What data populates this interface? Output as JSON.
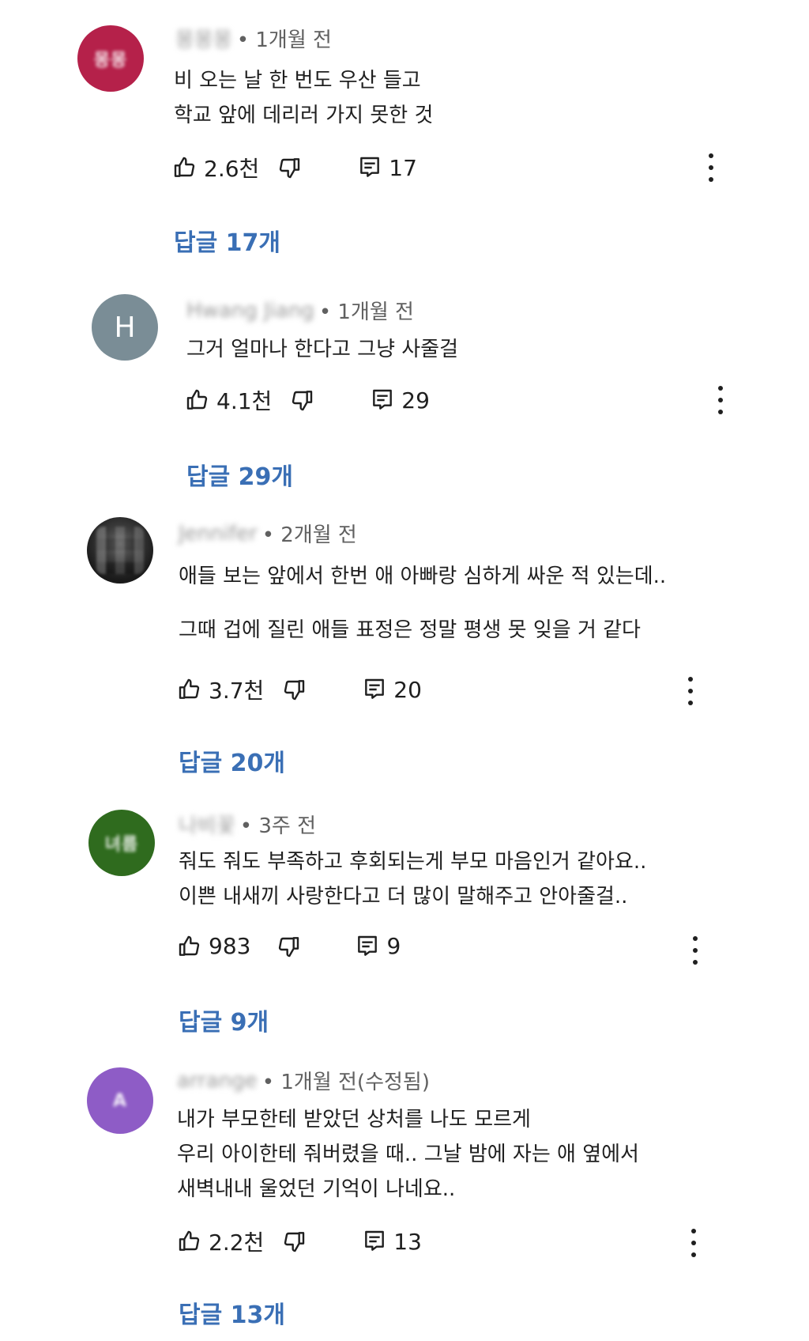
{
  "comments": [
    {
      "author": "몽몽몽",
      "time": "• 1개월 전",
      "avatar_text": "몽몽",
      "avatar_color": "#b5214a",
      "lines": [
        "비 오는 날 한 번도 우산 들고",
        "학교 앞에 데리러 가지 못한 것"
      ],
      "likes": "2.6천",
      "reply_count": "17",
      "replies_label": "답글 17개"
    },
    {
      "author": "Hwang Jiang",
      "time": "• 1개월 전",
      "avatar_text": "H",
      "avatar_color": "#7a8d96",
      "lines": [
        "그거 얼마나 한다고 그냥 사줄걸"
      ],
      "likes": "4.1천",
      "reply_count": "29",
      "replies_label": "답글 29개"
    },
    {
      "author": "Jennifer",
      "time": "• 2개월 전",
      "avatar_text": "",
      "avatar_color": "#2a2a2a",
      "lines": [
        "애들 보는 앞에서 한번 애 아빠랑 심하게 싸운 적 있는데..",
        "",
        "그때 겁에 질린 애들 표정은 정말 평생 못 잊을 거 같다"
      ],
      "likes": "3.7천",
      "reply_count": "20",
      "replies_label": "답글 20개"
    },
    {
      "author": "나비꽃",
      "time": "• 3주 전",
      "avatar_text": "녀름",
      "avatar_color": "#2f6b1e",
      "lines": [
        "줘도 줘도 부족하고 후회되는게 부모 마음인거 같아요..",
        "이쁜 내새끼 사랑한다고 더 많이 말해주고 안아줄걸.."
      ],
      "likes": "983",
      "reply_count": "9",
      "replies_label": "답글 9개"
    },
    {
      "author": "arrange",
      "time": "• 1개월 전(수정됨)",
      "avatar_text": "A",
      "avatar_color": "#8e5cc6",
      "lines": [
        "내가 부모한테 받았던 상처를 나도 모르게",
        "우리 아이한테 줘버렸을 때.. 그날 밤에 자는 애 옆에서",
        "새벽내내 울었던 기억이 나네요.."
      ],
      "likes": "2.2천",
      "reply_count": "13",
      "replies_label": "답글 13개"
    }
  ],
  "icons": {
    "like": "thumbs-up-icon",
    "dislike": "thumbs-down-icon",
    "reply": "comment-icon",
    "more": "more-vert-icon"
  }
}
